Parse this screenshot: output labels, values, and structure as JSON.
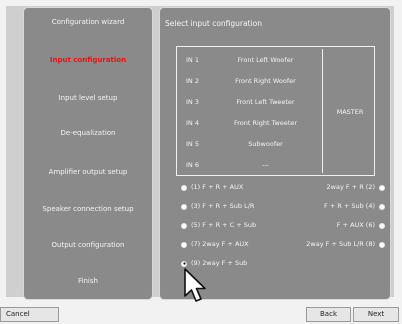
{
  "sidebar": {
    "items": [
      {
        "label": "Configuration wizard",
        "active": false
      },
      {
        "label": "Input configuration",
        "active": true
      },
      {
        "label": "Input level setup",
        "active": false
      },
      {
        "label": "De-equalization",
        "active": false
      },
      {
        "label": "Amplifier output setup",
        "active": false
      },
      {
        "label": "Speaker connection setup",
        "active": false
      },
      {
        "label": "Output configuration",
        "active": false
      },
      {
        "label": "Finish",
        "active": false
      }
    ]
  },
  "main": {
    "title": "Select input configuration",
    "table": {
      "rows": [
        {
          "input": "IN 1",
          "name": "Front Left Woofer"
        },
        {
          "input": "IN 2",
          "name": "Front Right Woofer"
        },
        {
          "input": "IN 3",
          "name": "Front Left Tweeter"
        },
        {
          "input": "IN 4",
          "name": "Front Right Tweeter"
        },
        {
          "input": "IN 5",
          "name": "Subwoofer"
        },
        {
          "input": "IN 6",
          "name": "---"
        }
      ],
      "master_label": "MASTER"
    },
    "options_left": [
      {
        "label": "(1) F + R + AUX",
        "selected": false
      },
      {
        "label": "(3) F + R + Sub L/R",
        "selected": false
      },
      {
        "label": "(5) F + R + C + Sub",
        "selected": false
      },
      {
        "label": "(7) 2way F + AUX",
        "selected": false
      },
      {
        "label": "(9) 2way F + Sub",
        "selected": true
      }
    ],
    "options_right": [
      {
        "label": "2way F + R (2)",
        "selected": false
      },
      {
        "label": "F + R + Sub (4)",
        "selected": false
      },
      {
        "label": "F + AUX (6)",
        "selected": false
      },
      {
        "label": "2way F + Sub L/R (8)",
        "selected": false
      }
    ]
  },
  "footer": {
    "cancel_label": "Cancel",
    "back_label": "Back",
    "next_label": "Next"
  },
  "colors": {
    "panel_bg": "#8a8a8a",
    "active_item": "#ee1111",
    "text": "#f4f4f4"
  }
}
